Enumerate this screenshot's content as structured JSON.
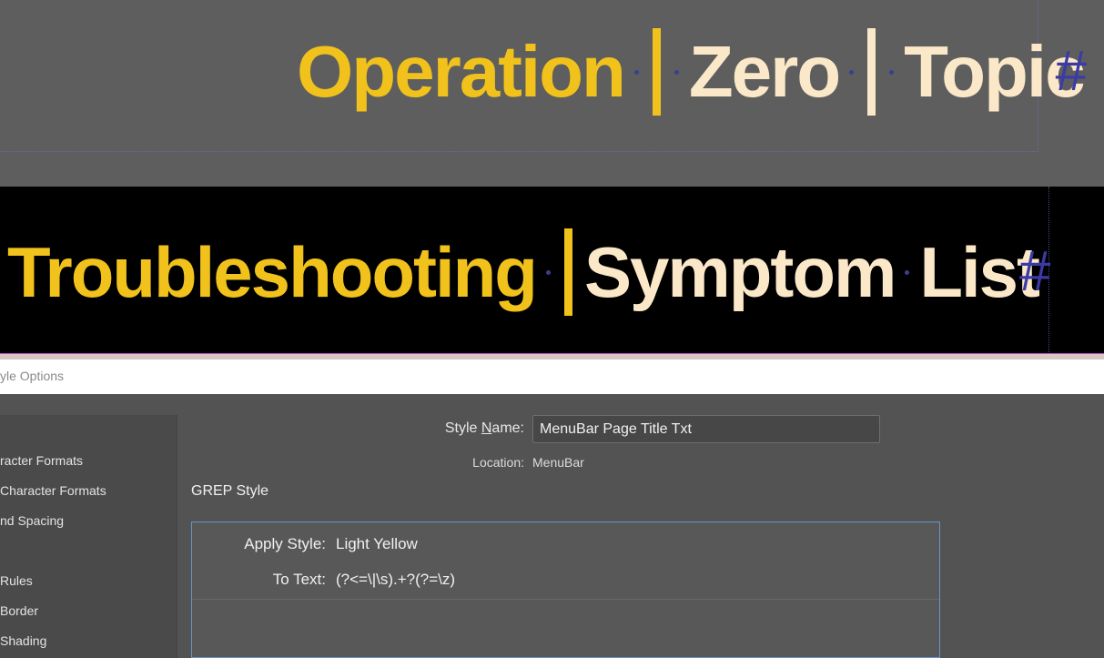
{
  "document": {
    "title_1": {
      "part_1": "Operation",
      "part_2": "Zero",
      "part_3": "Topic",
      "end_marker": "#"
    },
    "title_2": {
      "part_1": "Troubleshooting",
      "part_2": "Symptom",
      "part_3": "List",
      "end_marker": "#"
    },
    "colors": {
      "yellow": "#f1c21b",
      "light_yellow": "#fbe8c8",
      "hidden_char": "#3b3aa6"
    }
  },
  "dialog": {
    "title": "yle Options",
    "sidebar": {
      "items": [
        "racter Formats",
        "Character Formats",
        "nd Spacing",
        "Rules",
        "Border",
        "Shading"
      ]
    },
    "style_name_label_pre": "Style ",
    "style_name_label_accel": "N",
    "style_name_label_post": "ame:",
    "style_name_value": "MenuBar Page Title Txt",
    "location_label": "Location:",
    "location_value": "MenuBar",
    "section_heading": "GREP Style",
    "grep": {
      "apply_style_label": "Apply Style:",
      "apply_style_value": "Light Yellow",
      "to_text_label": "To Text:",
      "to_text_value": "(?<=\\|\\s).+?(?=\\z)"
    }
  }
}
